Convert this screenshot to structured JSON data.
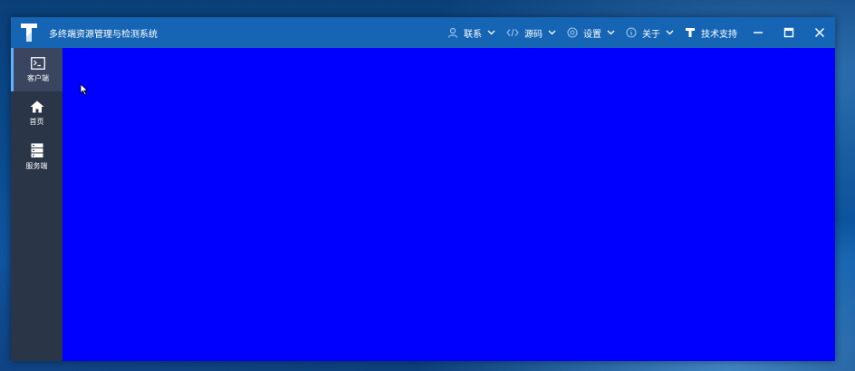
{
  "window": {
    "title": "多终端资源管理与检测系统"
  },
  "menu": {
    "items": [
      {
        "label": "联系",
        "icon": "user-icon",
        "has_dropdown": true
      },
      {
        "label": "源码",
        "icon": "code-icon",
        "has_dropdown": true
      },
      {
        "label": "设置",
        "icon": "settings-icon",
        "has_dropdown": true
      },
      {
        "label": "关于",
        "icon": "info-icon",
        "has_dropdown": true
      },
      {
        "label": "技术支持",
        "icon": "t-logo-icon",
        "has_dropdown": false
      }
    ]
  },
  "window_controls": {
    "minimize": "minimize-icon",
    "maximize": "maximize-icon",
    "close": "close-icon"
  },
  "sidebar": {
    "items": [
      {
        "label": "客户端",
        "icon": "terminal-icon",
        "active": true
      },
      {
        "label": "首页",
        "icon": "home-icon",
        "active": false
      },
      {
        "label": "服务端",
        "icon": "server-icon",
        "active": false
      }
    ]
  },
  "colors": {
    "titlebar": "#1565b4",
    "sidebar": "#2b3548",
    "content": "#0000ff",
    "accent": "#5fb0ff"
  }
}
